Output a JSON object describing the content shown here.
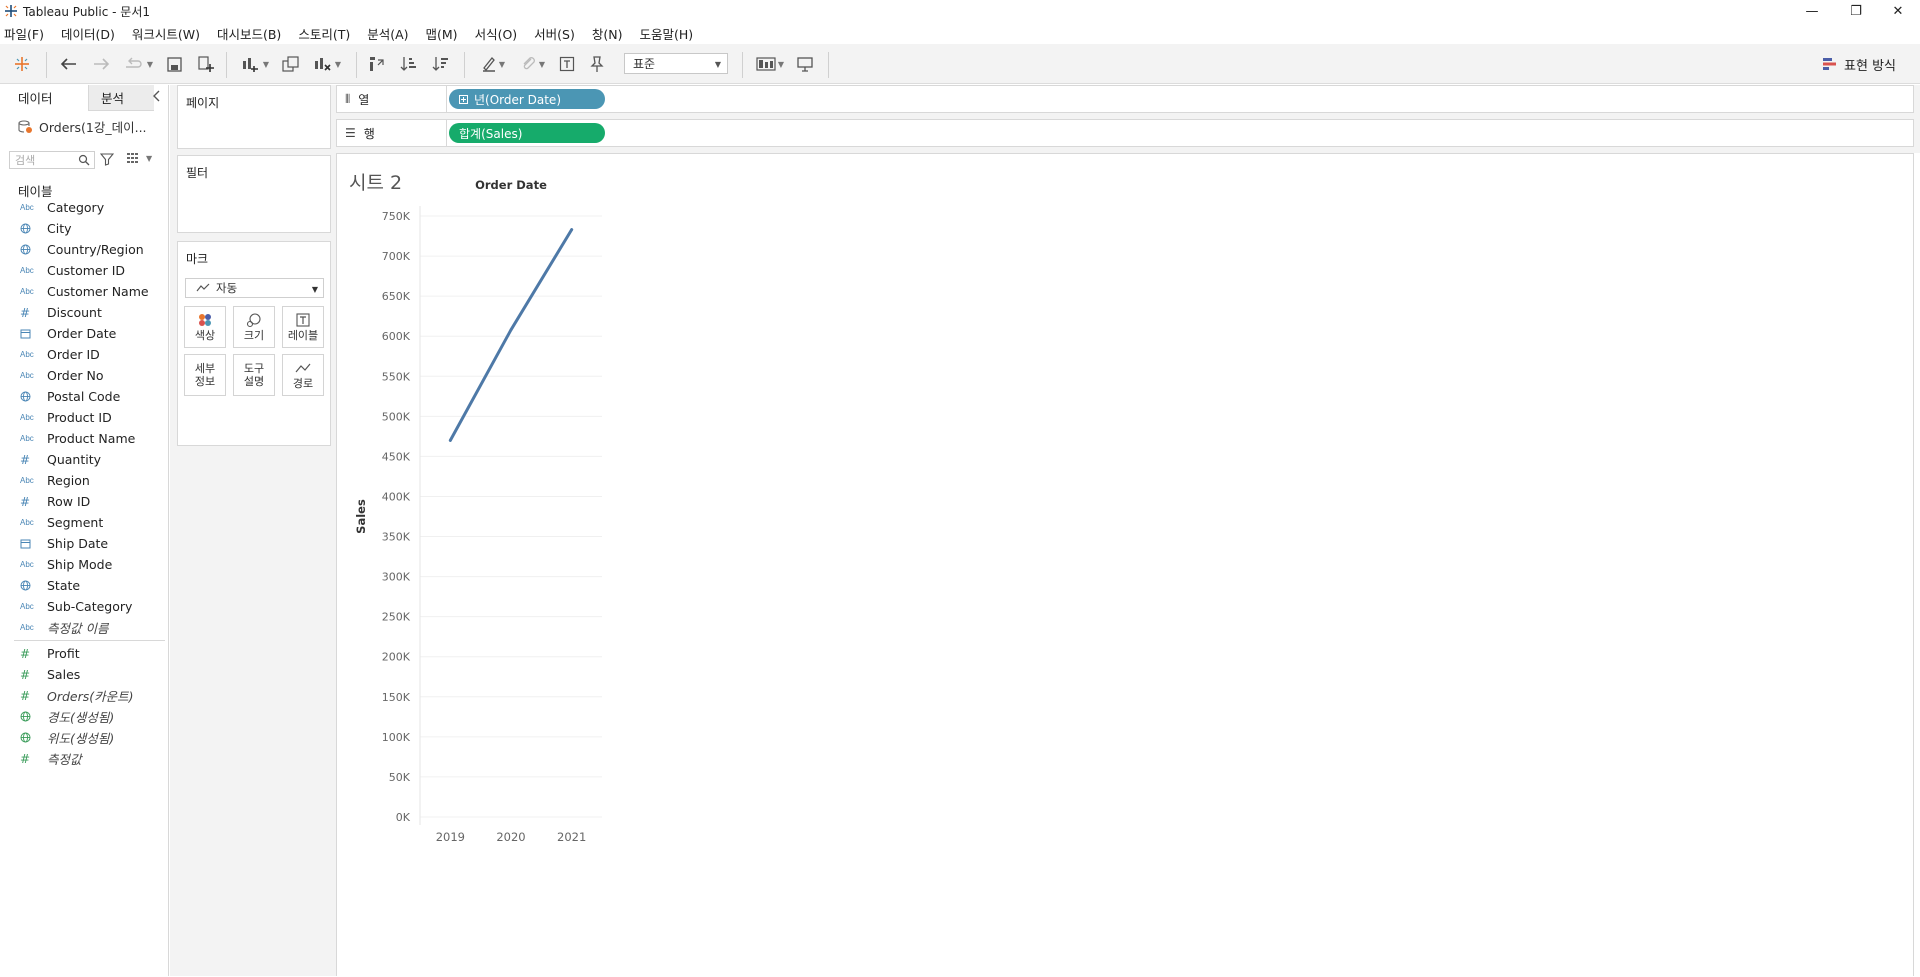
{
  "window": {
    "title": "Tableau Public - 문서1",
    "minimize": "—",
    "restore": "❐",
    "close": "✕"
  },
  "menu": [
    "파일(F)",
    "데이터(D)",
    "워크시트(W)",
    "대시보드(B)",
    "스토리(T)",
    "분석(A)",
    "맵(M)",
    "서식(O)",
    "서버(S)",
    "창(N)",
    "도움말(H)"
  ],
  "toolbar": {
    "fit_value": "표준",
    "show_me_label": "표현 방식"
  },
  "data_pane": {
    "tab_data": "데이터",
    "tab_analytics": "분석",
    "datasource": "Orders(1강_데이...",
    "search_placeholder": "검색",
    "tables_heading": "테이블",
    "dimensions": [
      {
        "name": "Category",
        "type": "abc",
        "italic": false
      },
      {
        "name": "City",
        "type": "geo",
        "italic": false
      },
      {
        "name": "Country/Region",
        "type": "geo",
        "italic": false
      },
      {
        "name": "Customer ID",
        "type": "abc",
        "italic": false
      },
      {
        "name": "Customer Name",
        "type": "abc",
        "italic": false
      },
      {
        "name": "Discount",
        "type": "numblue",
        "italic": false
      },
      {
        "name": "Order Date",
        "type": "date",
        "italic": false
      },
      {
        "name": "Order ID",
        "type": "abc",
        "italic": false
      },
      {
        "name": "Order No",
        "type": "abc",
        "italic": false
      },
      {
        "name": "Postal Code",
        "type": "geo",
        "italic": false
      },
      {
        "name": "Product ID",
        "type": "abc",
        "italic": false
      },
      {
        "name": "Product Name",
        "type": "abc",
        "italic": false
      },
      {
        "name": "Quantity",
        "type": "numblue",
        "italic": false
      },
      {
        "name": "Region",
        "type": "abc",
        "italic": false
      },
      {
        "name": "Row ID",
        "type": "numblue",
        "italic": false
      },
      {
        "name": "Segment",
        "type": "abc",
        "italic": false
      },
      {
        "name": "Ship Date",
        "type": "date",
        "italic": false
      },
      {
        "name": "Ship Mode",
        "type": "abc",
        "italic": false
      },
      {
        "name": "State",
        "type": "geo",
        "italic": false
      },
      {
        "name": "Sub-Category",
        "type": "abc",
        "italic": false
      },
      {
        "name": "측정값 이름",
        "type": "abc",
        "italic": true
      }
    ],
    "measures": [
      {
        "name": "Profit",
        "type": "num",
        "italic": false
      },
      {
        "name": "Sales",
        "type": "num",
        "italic": false
      },
      {
        "name": "Orders(카운트)",
        "type": "num",
        "italic": true
      },
      {
        "name": "경도(생성됨)",
        "type": "geogreen",
        "italic": true
      },
      {
        "name": "위도(생성됨)",
        "type": "geogreen",
        "italic": true
      },
      {
        "name": "측정값",
        "type": "num",
        "italic": true
      }
    ]
  },
  "cards": {
    "pages_title": "페이지",
    "filters_title": "필터",
    "marks_title": "마크",
    "marks_type": "자동",
    "btn_color": "색상",
    "btn_size": "크기",
    "btn_label": "레이블",
    "btn_detail_1": "세부",
    "btn_detail_2": "정보",
    "btn_tooltip_1": "도구",
    "btn_tooltip_2": "설명",
    "btn_path": "경로"
  },
  "shelves": {
    "columns_label": "열",
    "columns_pill": "년(Order Date)",
    "rows_label": "행",
    "rows_pill": "합계(Sales)"
  },
  "sheet": {
    "title": "시트 2"
  },
  "chart_data": {
    "type": "line",
    "title": "Order Date",
    "xlabel": "",
    "ylabel": "Sales",
    "x": [
      "2019",
      "2020",
      "2021"
    ],
    "series": [
      {
        "values": [
          470000,
          608000,
          733000
        ]
      }
    ],
    "ylim": [
      0,
      750000
    ],
    "yticks": [
      0,
      50000,
      100000,
      150000,
      200000,
      250000,
      300000,
      350000,
      400000,
      450000,
      500000,
      550000,
      600000,
      650000,
      700000,
      750000
    ],
    "ytick_labels": [
      "0K",
      "50K",
      "100K",
      "150K",
      "200K",
      "250K",
      "300K",
      "350K",
      "400K",
      "450K",
      "500K",
      "550K",
      "600K",
      "650K",
      "700K",
      "750K"
    ],
    "line_color": "#4e79a7",
    "grid": true
  }
}
